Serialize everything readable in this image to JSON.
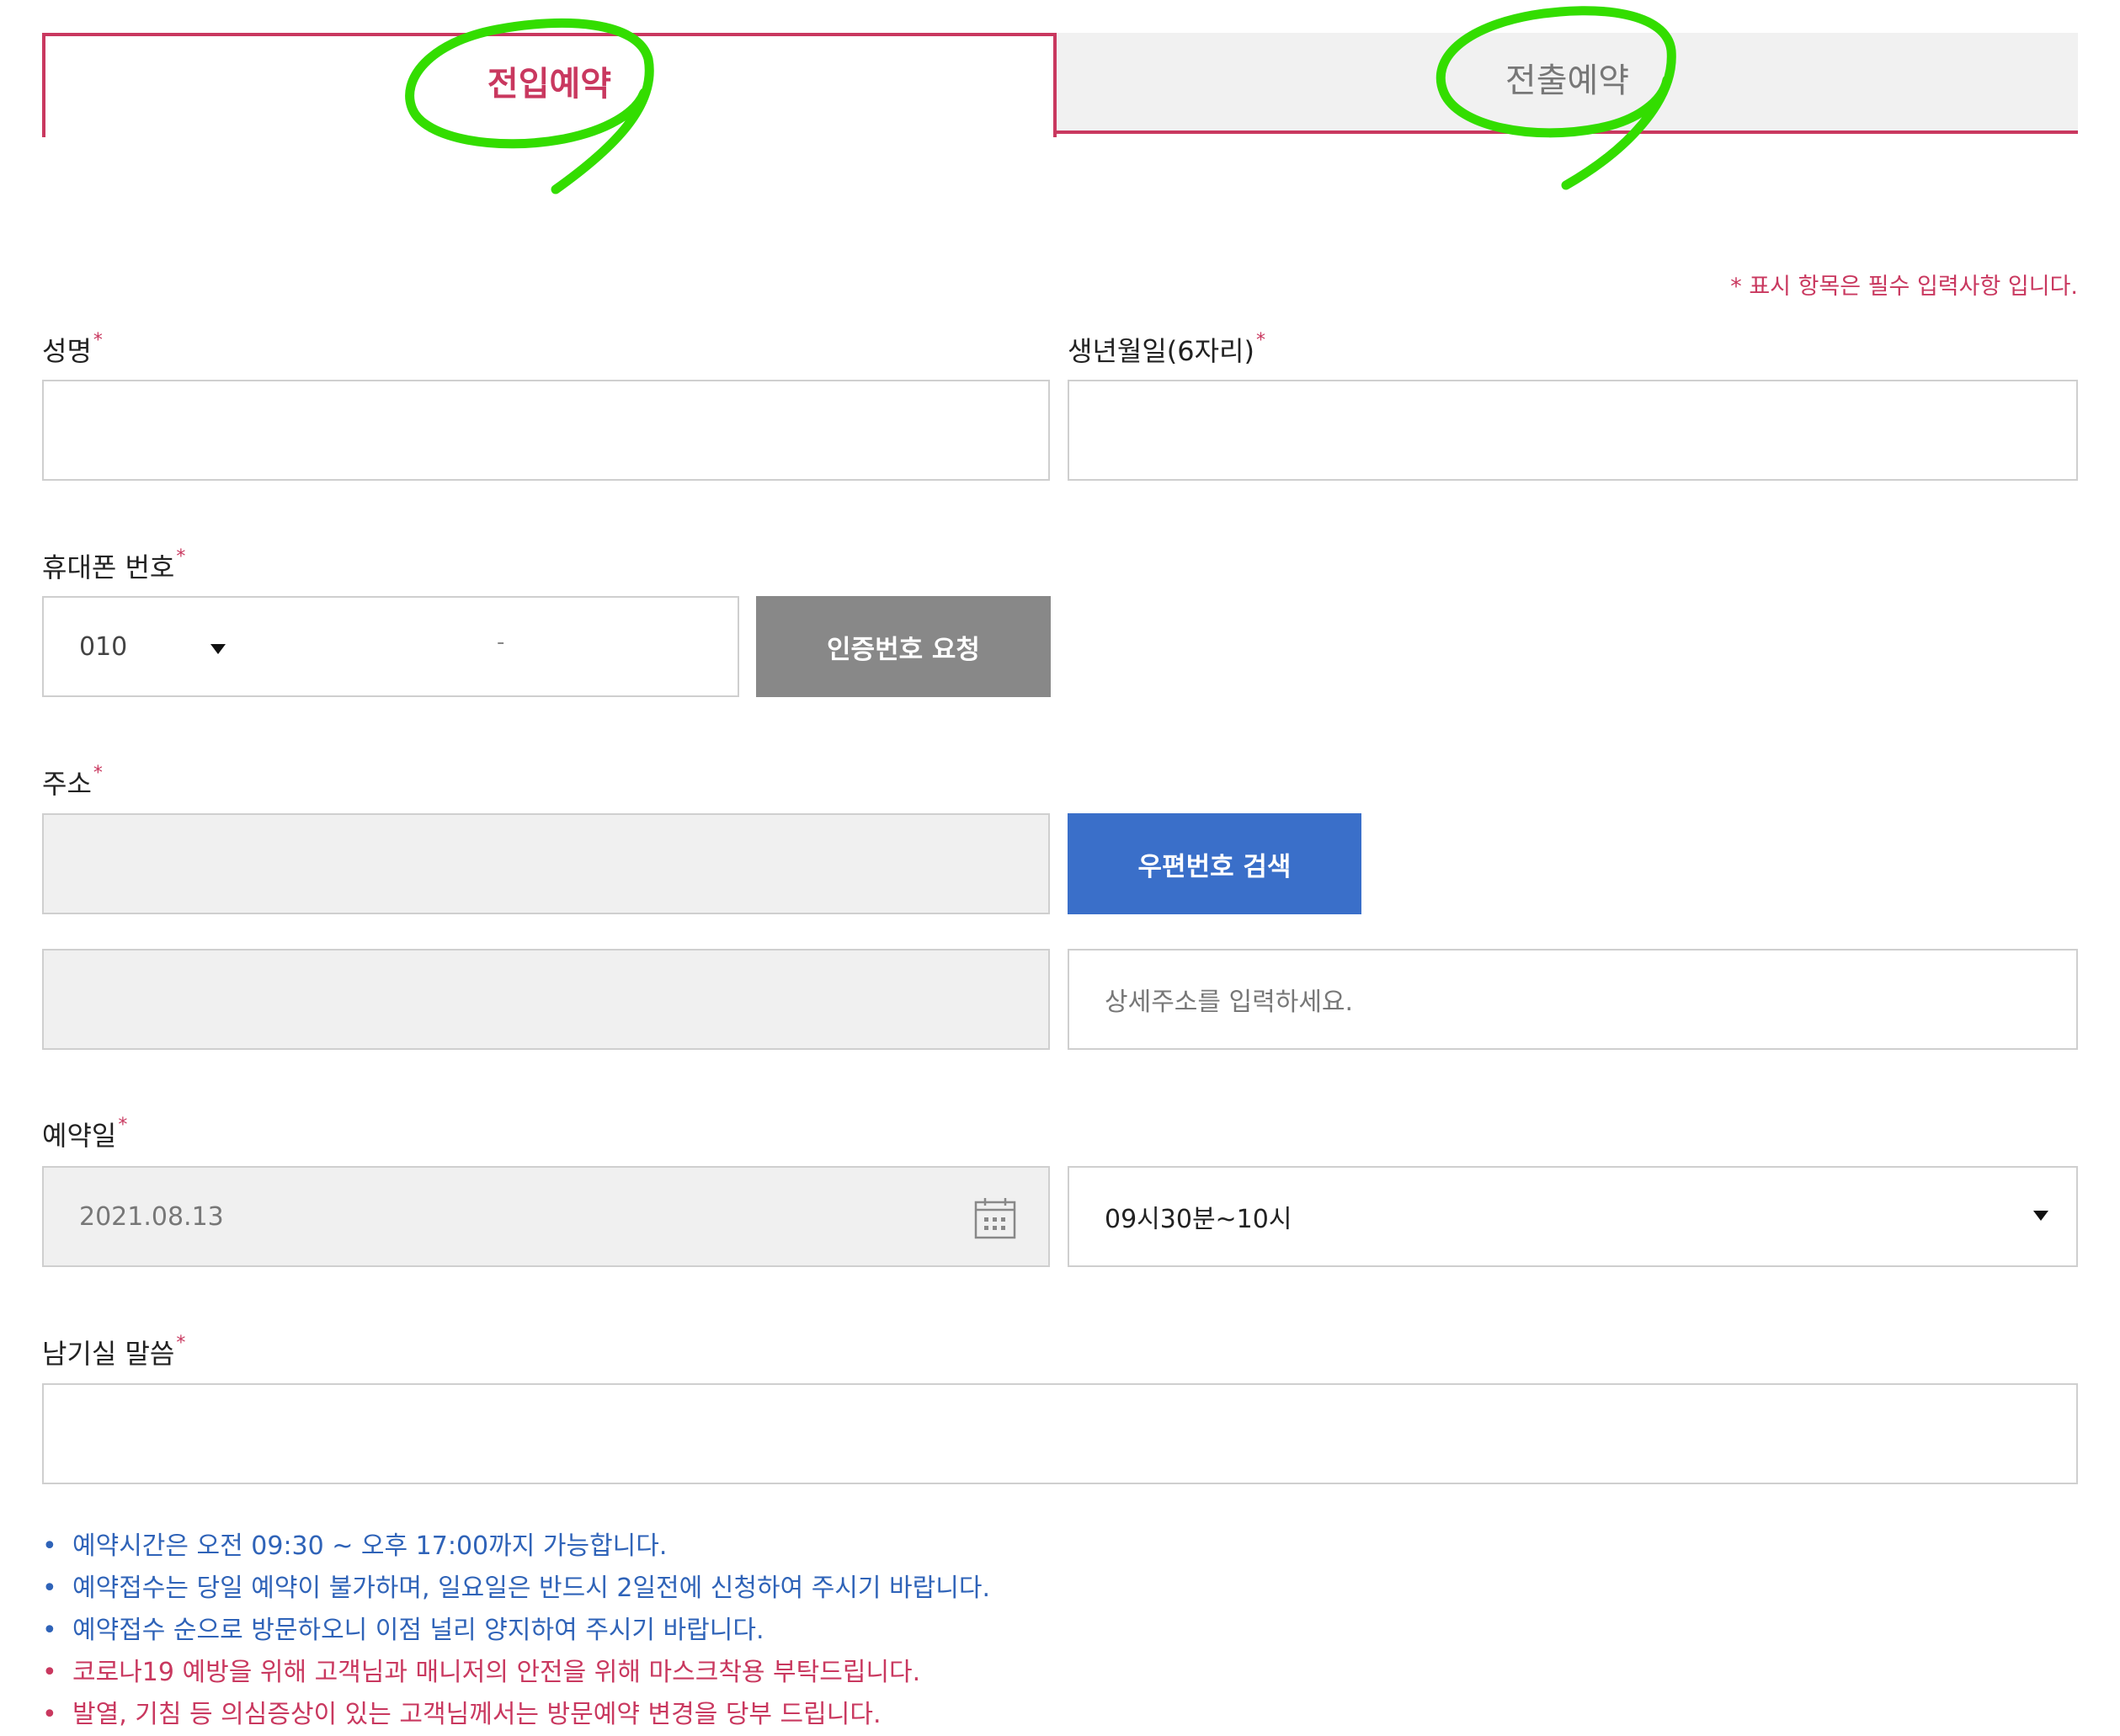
{
  "tabs": {
    "active": "전입예약",
    "inactive": "전출예약"
  },
  "required_notice": "* 표시 항목은 필수 입력사항 입니다.",
  "required_mark": "*",
  "form": {
    "name": {
      "label": "성명",
      "value": ""
    },
    "birth": {
      "label": "생년월일(6자리)",
      "value": ""
    },
    "phone": {
      "label": "휴대폰 번호",
      "prefix": "010",
      "separator": "-",
      "verify_button": "인증번호 요청"
    },
    "address": {
      "label": "주소",
      "search_button": "우편번호 검색",
      "detail_placeholder": "상세주소를 입력하세요."
    },
    "reservation": {
      "label": "예약일",
      "date": "2021.08.13",
      "time": "09시30분~10시"
    },
    "message": {
      "label": "남기실 말씀",
      "value": ""
    }
  },
  "notes": [
    {
      "text": "예약시간은 오전 09:30 ~ 오후 17:00까지 가능합니다.",
      "color": "blue"
    },
    {
      "text": "예약접수는 당일 예약이 불가하며, 일요일은 반드시 2일전에 신청하여 주시기 바랍니다.",
      "color": "blue"
    },
    {
      "text": "예약접수 순으로 방문하오니 이점 널리 양지하여 주시기 바랍니다.",
      "color": "blue"
    },
    {
      "text": "코로나19 예방을 위해 고객님과 매니저의 안전을 위해 마스크착용 부탁드립니다.",
      "color": "red"
    },
    {
      "text": "발열, 기침 등 의심증상이 있는 고객님께서는 방문예약 변경을 당부 드립니다.",
      "color": "red"
    }
  ],
  "colors": {
    "accent": "#c9385f",
    "blue_button": "#3a6fc9",
    "gray_button": "#888888",
    "annotation": "#33dd00"
  }
}
